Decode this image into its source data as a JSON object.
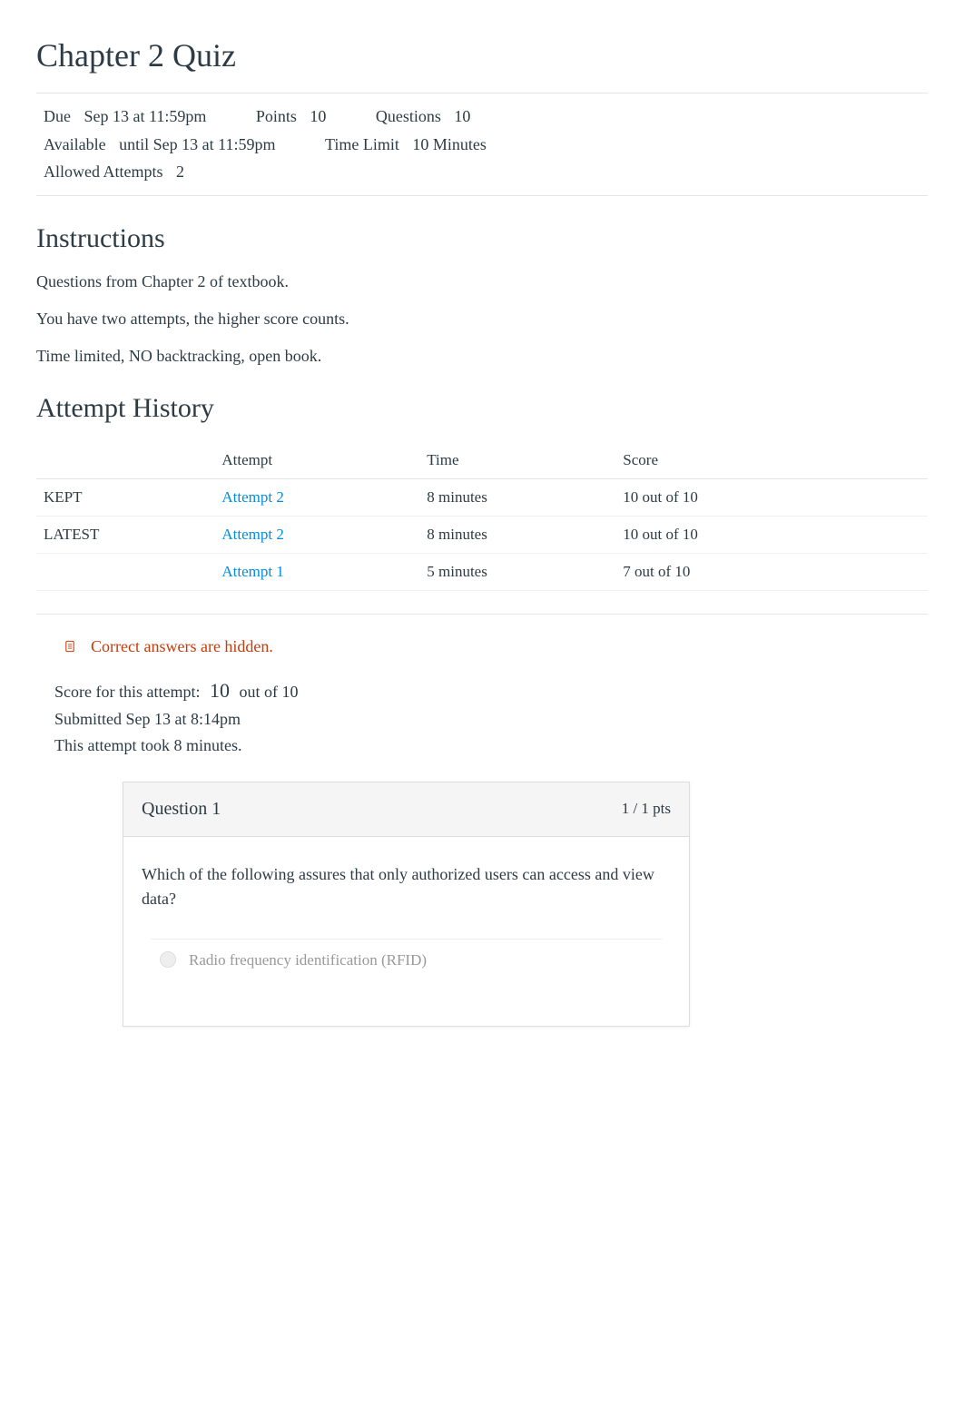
{
  "title": "Chapter 2 Quiz",
  "metadata": {
    "due_label": "Due",
    "due_value": "Sep 13 at 11:59pm",
    "points_label": "Points",
    "points_value": "10",
    "questions_label": "Questions",
    "questions_value": "10",
    "available_label": "Available",
    "available_value": "until Sep 13 at 11:59pm",
    "timelimit_label": "Time Limit",
    "timelimit_value": "10 Minutes",
    "attempts_label": "Allowed Attempts",
    "attempts_value": "2"
  },
  "instructions": {
    "heading": "Instructions",
    "p1": "Questions from Chapter 2 of textbook.",
    "p2": "You have two attempts, the higher score counts.",
    "p3": "Time limited, NO backtracking, open book."
  },
  "history": {
    "heading": "Attempt History",
    "headers": {
      "status": "",
      "attempt": "Attempt",
      "time": "Time",
      "score": "Score"
    },
    "rows": [
      {
        "status": "KEPT",
        "attempt": "Attempt 2",
        "time": "8 minutes",
        "score": "10 out of 10"
      },
      {
        "status": "LATEST",
        "attempt": "Attempt 2",
        "time": "8 minutes",
        "score": "10 out of 10"
      },
      {
        "status": "",
        "attempt": "Attempt 1",
        "time": "5 minutes",
        "score": "7 out of 10"
      }
    ]
  },
  "hidden_notice": "Correct answers are hidden.",
  "score_attempt": {
    "label": "Score for this attempt:",
    "score": "10",
    "suffix": "out of 10",
    "submitted": "Submitted Sep 13 at 8:14pm",
    "duration": "This attempt took 8 minutes."
  },
  "question": {
    "title": "Question 1",
    "pts": "1 / 1 pts",
    "text": "Which of the following assures that only authorized users can access and view data?",
    "answer1": "Radio frequency identification (RFID)"
  }
}
